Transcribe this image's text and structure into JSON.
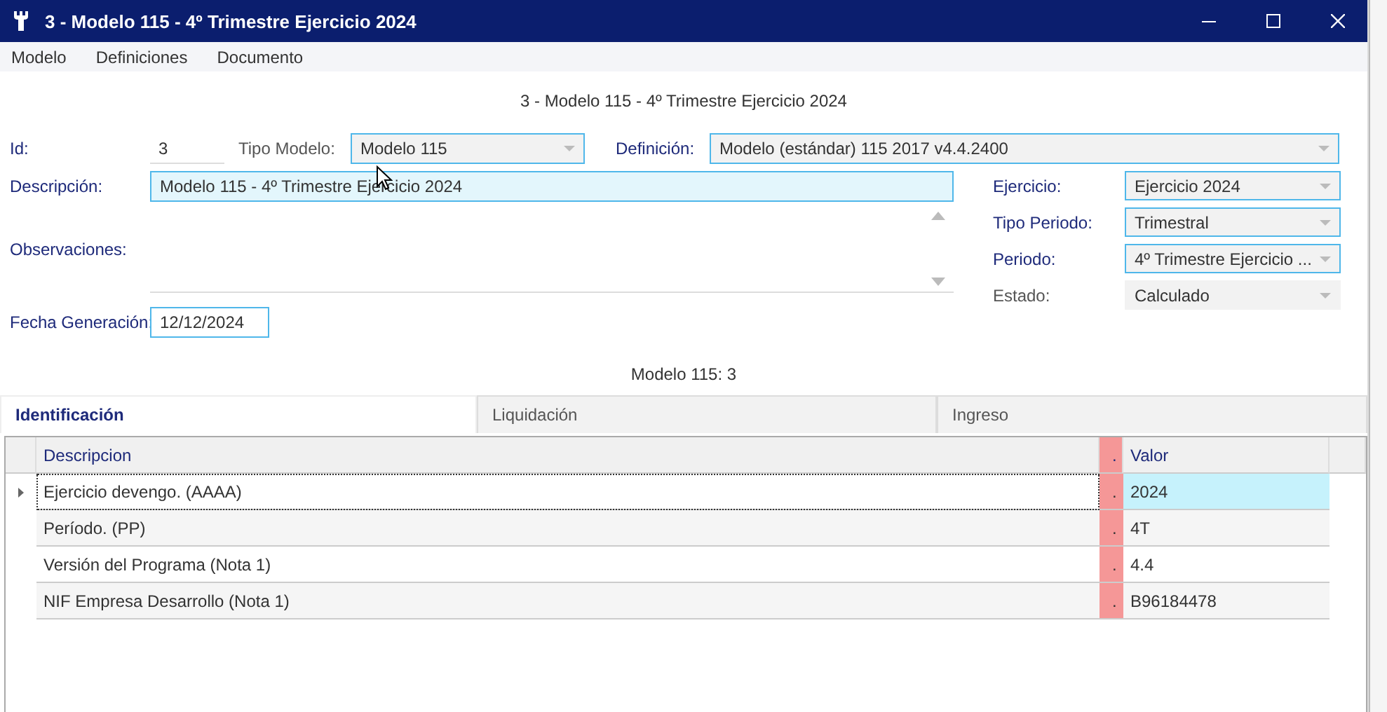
{
  "window": {
    "title": "3 - Modelo 115 - 4º Trimestre Ejercicio 2024"
  },
  "menu": [
    "Modelo",
    "Definiciones",
    "Documento"
  ],
  "heading": "3 - Modelo 115 - 4º Trimestre Ejercicio 2024",
  "top_fields": [
    {
      "label": "Id:",
      "value": "3",
      "kind": "plain",
      "required": true,
      "highlighted": false
    },
    {
      "label": "Tipo Modelo:",
      "value": "Modelo 115",
      "kind": "combo",
      "required": false,
      "highlighted": true
    },
    {
      "label": "Definición:",
      "value": "Modelo (estándar) 115 2017 v4.4.2400",
      "kind": "combo",
      "required": true,
      "highlighted": true
    }
  ],
  "left_fields": [
    {
      "label": "Descripción:",
      "value": "Modelo 115 - 4º Trimestre Ejercicio 2024",
      "kind": "text",
      "required": true,
      "highlighted": true,
      "focused": true
    },
    {
      "label": "Observaciones:",
      "kind": "memo",
      "required": true,
      "focused": false
    },
    {
      "label": "Fecha Generación:",
      "value": "12/12/2024",
      "kind": "text",
      "required": true,
      "highlighted": true,
      "focused": false
    }
  ],
  "right_fields": [
    {
      "label": "Ejercicio:",
      "value": "Ejercicio 2024",
      "required": true,
      "highlighted": true
    },
    {
      "label": "Tipo Periodo:",
      "value": "Trimestral",
      "required": true,
      "highlighted": true
    },
    {
      "label": "Periodo:",
      "value": "4º Trimestre Ejercicio ...",
      "required": true,
      "highlighted": true
    },
    {
      "label": "Estado:",
      "value": "Calculado",
      "required": false,
      "highlighted": false
    }
  ],
  "subtitle": "Modelo 115: 3",
  "tabs": [
    {
      "label": "Identificación",
      "selected": true
    },
    {
      "label": "Liquidación",
      "selected": false
    },
    {
      "label": "Ingreso",
      "selected": false
    }
  ],
  "table": {
    "columns": [
      {
        "label": "Descripcion",
        "highlighted": false
      },
      {
        "label": ".",
        "highlighted": true
      },
      {
        "label": "Valor",
        "highlighted": false
      }
    ],
    "rows": [
      {
        "cells": [
          "Ejercicio devengo. (AAAA)",
          ".",
          "2024"
        ],
        "selected": true
      },
      {
        "cells": [
          "Período. (PP)",
          ".",
          "4T"
        ],
        "selected": false
      },
      {
        "cells": [
          "Versión del Programa (Nota 1)",
          ".",
          "4.4"
        ],
        "selected": false
      },
      {
        "cells": [
          "NIF Empresa Desarrollo (Nota 1)",
          ".",
          "B96184478"
        ],
        "selected": false
      }
    ]
  }
}
